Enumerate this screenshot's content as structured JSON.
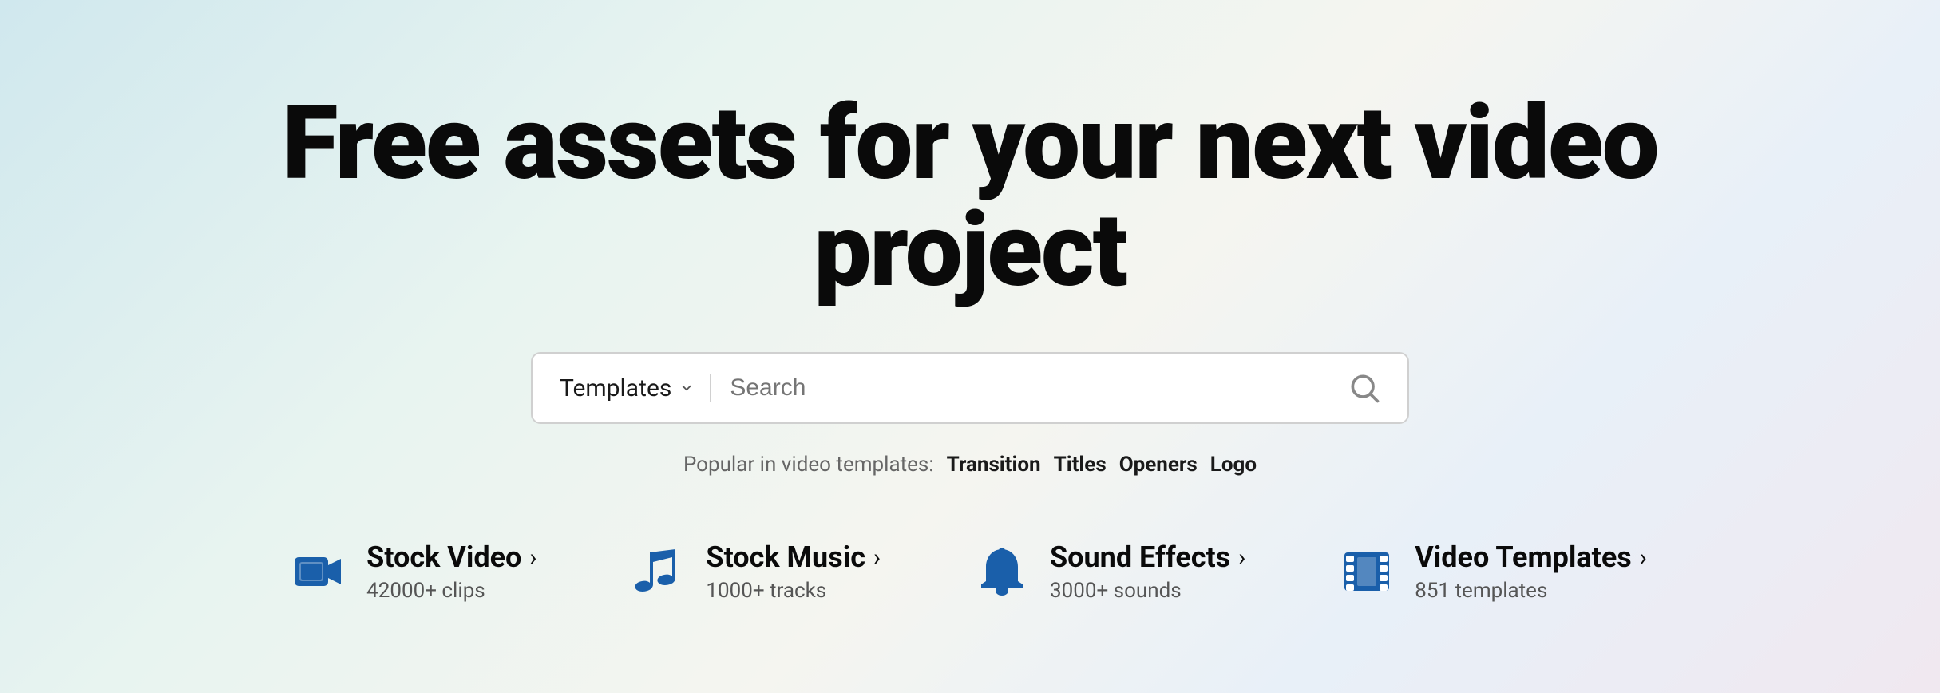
{
  "hero": {
    "title": "Free assets for your next video project"
  },
  "search": {
    "dropdown_label": "Templates",
    "placeholder": "Search",
    "popular_label": "Popular in video templates:",
    "popular_tags": [
      "Transition",
      "Titles",
      "Openers",
      "Logo"
    ]
  },
  "categories": [
    {
      "id": "stock-video",
      "title": "Stock Video",
      "subtitle": "42000+ clips",
      "arrow": "›"
    },
    {
      "id": "stock-music",
      "title": "Stock Music",
      "subtitle": "1000+ tracks",
      "arrow": "›"
    },
    {
      "id": "sound-effects",
      "title": "Sound Effects",
      "subtitle": "3000+ sounds",
      "arrow": "›"
    },
    {
      "id": "video-templates",
      "title": "Video Templates",
      "subtitle": "851 templates",
      "arrow": "›"
    }
  ]
}
